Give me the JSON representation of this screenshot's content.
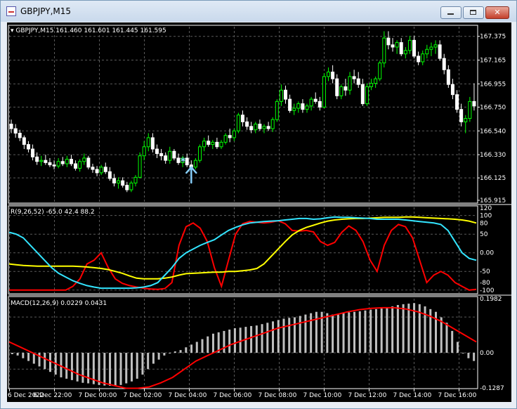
{
  "window": {
    "title": "GBPJPY,M15",
    "icon": "chart-window-icon",
    "minimize_icon": "minimize-icon",
    "maximize_icon": "maximize-icon",
    "close_icon": "close-icon",
    "close_glyph": "✕"
  },
  "colors": {
    "background": "#000000",
    "grid": "#5a5a5a",
    "bull_candle": "#00ff00",
    "bear_candle": "#ffffff",
    "axis_text": "#ffffff",
    "wpr_line": "#ff0000",
    "stoch_line": "#ffff00",
    "cyan_line": "#33e5ff",
    "macd_hist": "#c0c0c0",
    "macd_signal": "#ff0000",
    "arrow": "#87cefa"
  },
  "price_panel": {
    "header": "GBPJPY,M15  161.460 161.601 161.445 161.595",
    "price_axis": [
      "167.375",
      "167.165",
      "166.955",
      "166.750",
      "166.540",
      "166.330",
      "166.125",
      "165.915"
    ]
  },
  "osc_panel": {
    "label": "R(9,26,52) -65.0 42.4 88.2",
    "axis": [
      "120",
      "100",
      "80",
      "50",
      "0.00",
      "-50",
      "-80",
      "-100"
    ]
  },
  "macd_panel": {
    "label": "MACD(12,26,9) 0.0229 0.0431",
    "axis": [
      "0.1982",
      "0.00",
      "-0.1287"
    ]
  },
  "time_axis": [
    "6 Dec 2022",
    "6 Dec 22:00",
    "7 Dec 00:00",
    "7 Dec 02:00",
    "7 Dec 04:00",
    "7 Dec 06:00",
    "7 Dec 08:00",
    "7 Dec 10:00",
    "7 Dec 12:00",
    "7 Dec 14:00",
    "7 Dec 16:00"
  ],
  "chart_data": {
    "type": "candlestick",
    "symbol": "GBPJPY",
    "timeframe": "M15",
    "ylim": [
      165.915,
      167.46
    ],
    "ohlc": [
      [
        166.6,
        166.64,
        166.52,
        166.56
      ],
      [
        166.56,
        166.6,
        166.48,
        166.52
      ],
      [
        166.52,
        166.55,
        166.45,
        166.48
      ],
      [
        166.48,
        166.5,
        166.38,
        166.42
      ],
      [
        166.42,
        166.45,
        166.35,
        166.38
      ],
      [
        166.38,
        166.42,
        166.28,
        166.31
      ],
      [
        166.31,
        166.35,
        166.24,
        166.27
      ],
      [
        166.27,
        166.32,
        166.23,
        166.28
      ],
      [
        166.28,
        166.33,
        166.24,
        166.26
      ],
      [
        166.26,
        166.3,
        166.22,
        166.24
      ],
      [
        166.24,
        166.28,
        166.2,
        166.23
      ],
      [
        166.23,
        166.3,
        166.21,
        166.27
      ],
      [
        166.27,
        166.31,
        166.23,
        166.25
      ],
      [
        166.25,
        166.32,
        166.22,
        166.29
      ],
      [
        166.29,
        166.33,
        166.23,
        166.25
      ],
      [
        166.25,
        166.28,
        166.19,
        166.21
      ],
      [
        166.21,
        166.29,
        166.18,
        166.27
      ],
      [
        166.27,
        166.34,
        166.24,
        166.3
      ],
      [
        166.3,
        166.32,
        166.2,
        166.22
      ],
      [
        166.22,
        166.25,
        166.17,
        166.2
      ],
      [
        166.2,
        166.23,
        166.14,
        166.17
      ],
      [
        166.17,
        166.24,
        166.15,
        166.22
      ],
      [
        166.22,
        166.26,
        166.16,
        166.18
      ],
      [
        166.18,
        166.22,
        166.1,
        166.12
      ],
      [
        166.12,
        166.16,
        166.05,
        166.08
      ],
      [
        166.08,
        166.13,
        166.03,
        166.1
      ],
      [
        166.1,
        166.13,
        166.04,
        166.06
      ],
      [
        166.06,
        166.09,
        166.0,
        166.02
      ],
      [
        166.02,
        166.1,
        166.0,
        166.08
      ],
      [
        166.08,
        166.15,
        166.05,
        166.13
      ],
      [
        166.13,
        166.35,
        166.12,
        166.32
      ],
      [
        166.32,
        166.45,
        166.28,
        166.4
      ],
      [
        166.4,
        166.52,
        166.36,
        166.48
      ],
      [
        166.48,
        166.52,
        166.35,
        166.38
      ],
      [
        166.38,
        166.42,
        166.3,
        166.34
      ],
      [
        166.34,
        166.38,
        166.28,
        166.32
      ],
      [
        166.32,
        166.35,
        166.25,
        166.28
      ],
      [
        166.28,
        166.4,
        166.25,
        166.36
      ],
      [
        166.36,
        166.38,
        166.28,
        166.3
      ],
      [
        166.3,
        166.34,
        166.24,
        166.26
      ],
      [
        166.26,
        166.32,
        166.22,
        166.3
      ],
      [
        166.3,
        166.34,
        166.22,
        166.24
      ],
      [
        166.24,
        166.28,
        166.18,
        166.22
      ],
      [
        166.22,
        166.3,
        166.2,
        166.28
      ],
      [
        166.28,
        166.42,
        166.26,
        166.4
      ],
      [
        166.4,
        166.48,
        166.36,
        166.45
      ],
      [
        166.45,
        166.5,
        166.4,
        166.42
      ],
      [
        166.42,
        166.46,
        166.38,
        166.44
      ],
      [
        166.44,
        166.48,
        166.38,
        166.4
      ],
      [
        166.4,
        166.46,
        166.38,
        166.44
      ],
      [
        166.44,
        166.52,
        166.42,
        166.5
      ],
      [
        166.5,
        166.56,
        166.44,
        166.48
      ],
      [
        166.48,
        166.56,
        166.45,
        166.54
      ],
      [
        166.54,
        166.7,
        166.52,
        166.68
      ],
      [
        166.68,
        166.72,
        166.58,
        166.62
      ],
      [
        166.62,
        166.66,
        166.55,
        166.58
      ],
      [
        166.58,
        166.62,
        166.52,
        166.55
      ],
      [
        166.55,
        166.62,
        166.52,
        166.6
      ],
      [
        166.6,
        166.64,
        166.54,
        166.56
      ],
      [
        166.56,
        166.6,
        166.52,
        166.58
      ],
      [
        166.58,
        166.62,
        166.54,
        166.56
      ],
      [
        166.56,
        166.66,
        166.53,
        166.64
      ],
      [
        166.64,
        166.82,
        166.62,
        166.8
      ],
      [
        166.8,
        166.95,
        166.76,
        166.9
      ],
      [
        166.9,
        166.94,
        166.78,
        166.82
      ],
      [
        166.82,
        166.86,
        166.7,
        166.72
      ],
      [
        166.72,
        166.78,
        166.68,
        166.74
      ],
      [
        166.74,
        166.8,
        166.7,
        166.78
      ],
      [
        166.78,
        166.82,
        166.7,
        166.73
      ],
      [
        166.73,
        166.78,
        166.7,
        166.76
      ],
      [
        166.76,
        166.84,
        166.72,
        166.82
      ],
      [
        166.82,
        166.88,
        166.78,
        166.8
      ],
      [
        166.8,
        166.84,
        166.72,
        166.75
      ],
      [
        166.75,
        167.05,
        166.74,
        167.02
      ],
      [
        167.02,
        167.1,
        166.98,
        167.06
      ],
      [
        167.06,
        167.12,
        166.96,
        167.0
      ],
      [
        167.0,
        167.04,
        166.82,
        166.85
      ],
      [
        166.85,
        166.95,
        166.82,
        166.93
      ],
      [
        166.93,
        167.0,
        166.85,
        166.9
      ],
      [
        166.9,
        167.06,
        166.86,
        167.02
      ],
      [
        167.02,
        167.08,
        166.96,
        167.0
      ],
      [
        167.0,
        167.06,
        166.92,
        166.95
      ],
      [
        166.95,
        167.0,
        166.76,
        166.78
      ],
      [
        166.78,
        166.96,
        166.76,
        166.93
      ],
      [
        166.93,
        167.0,
        166.9,
        166.96
      ],
      [
        166.96,
        167.02,
        166.92,
        167.0
      ],
      [
        167.0,
        167.16,
        166.98,
        167.14
      ],
      [
        167.14,
        167.42,
        167.1,
        167.36
      ],
      [
        167.36,
        167.42,
        167.26,
        167.3
      ],
      [
        167.3,
        167.36,
        167.24,
        167.28
      ],
      [
        167.28,
        167.34,
        167.22,
        167.32
      ],
      [
        167.32,
        167.36,
        167.2,
        167.22
      ],
      [
        167.22,
        167.28,
        167.18,
        167.25
      ],
      [
        167.25,
        167.38,
        167.22,
        167.34
      ],
      [
        167.34,
        167.38,
        167.18,
        167.2
      ],
      [
        167.2,
        167.24,
        167.12,
        167.15
      ],
      [
        167.15,
        167.25,
        167.12,
        167.22
      ],
      [
        167.22,
        167.3,
        167.18,
        167.26
      ],
      [
        167.26,
        167.32,
        167.2,
        167.28
      ],
      [
        167.28,
        167.34,
        167.22,
        167.3
      ],
      [
        167.3,
        167.34,
        167.16,
        167.18
      ],
      [
        167.18,
        167.22,
        167.04,
        167.08
      ],
      [
        167.08,
        167.12,
        166.92,
        166.95
      ],
      [
        166.95,
        167.0,
        166.82,
        166.86
      ],
      [
        166.86,
        166.9,
        166.7,
        166.73
      ],
      [
        166.73,
        166.78,
        166.58,
        166.62
      ],
      [
        166.62,
        166.68,
        166.52,
        166.65
      ],
      [
        166.65,
        166.84,
        166.62,
        166.8
      ],
      [
        166.8,
        166.96,
        166.72,
        166.76
      ]
    ],
    "signal_marker": {
      "candle_index": 40,
      "price": 166.28
    },
    "arrow_marker": {
      "candle_index": 42,
      "price": 166.12
    },
    "oscillator": {
      "ylim": [
        -108,
        122
      ],
      "series": [
        {
          "name": "R(9)",
          "values": [
            -100,
            -100,
            -100,
            -100,
            -100,
            -100,
            -100,
            -100,
            -100,
            -90,
            -70,
            -30,
            -20,
            0,
            -40,
            -70,
            -82,
            -88,
            -92,
            -95,
            -97,
            -98,
            -96,
            -80,
            20,
            70,
            80,
            66,
            30,
            -40,
            -90,
            -20,
            50,
            78,
            84,
            82,
            80,
            82,
            86,
            78,
            60,
            58,
            60,
            56,
            30,
            20,
            28,
            55,
            72,
            60,
            30,
            -20,
            -50,
            20,
            60,
            76,
            70,
            40,
            -20,
            -80,
            -60,
            -50,
            -60,
            -80,
            -90,
            -100,
            -98
          ]
        },
        {
          "name": "R(26)",
          "values": [
            -30,
            -32,
            -34,
            -35,
            -36,
            -36,
            -36,
            -36,
            -36,
            -36,
            -37,
            -38,
            -40,
            -42,
            -45,
            -50,
            -55,
            -62,
            -68,
            -70,
            -70,
            -70,
            -68,
            -65,
            -60,
            -56,
            -55,
            -54,
            -53,
            -52,
            -52,
            -50,
            -50,
            -48,
            -46,
            -42,
            -30,
            -10,
            10,
            30,
            48,
            60,
            68,
            74,
            80,
            85,
            88,
            90,
            91,
            92,
            92,
            93,
            94,
            95,
            95,
            95,
            96,
            96,
            95,
            94,
            93,
            92,
            91,
            90,
            88,
            85,
            80
          ]
        },
        {
          "name": "R(52)",
          "values": [
            55,
            50,
            40,
            20,
            0,
            -20,
            -40,
            -55,
            -65,
            -75,
            -82,
            -88,
            -92,
            -95,
            -95,
            -95,
            -95,
            -95,
            -94,
            -92,
            -88,
            -80,
            -60,
            -40,
            -15,
            0,
            10,
            20,
            28,
            35,
            48,
            60,
            68,
            75,
            80,
            82,
            84,
            85,
            86,
            88,
            90,
            92,
            92,
            90,
            91,
            94,
            96,
            95,
            95,
            94,
            93,
            92,
            90,
            90,
            90,
            90,
            88,
            86,
            84,
            82,
            80,
            76,
            60,
            30,
            0,
            -15,
            -20
          ]
        }
      ]
    },
    "macd": {
      "ylim": [
        -0.1287,
        0.1982
      ],
      "histogram": [
        -0.005,
        -0.01,
        -0.02,
        -0.03,
        -0.04,
        -0.05,
        -0.06,
        -0.07,
        -0.08,
        -0.09,
        -0.095,
        -0.1,
        -0.105,
        -0.11,
        -0.112,
        -0.115,
        -0.118,
        -0.12,
        -0.121,
        -0.122,
        -0.118,
        -0.112,
        -0.105,
        -0.095,
        -0.08,
        -0.06,
        -0.04,
        -0.025,
        -0.01,
        0.0,
        0.005,
        0.01,
        0.02,
        0.03,
        0.04,
        0.05,
        0.06,
        0.07,
        0.075,
        0.08,
        0.085,
        0.09,
        0.092,
        0.095,
        0.098,
        0.1,
        0.105,
        0.11,
        0.115,
        0.12,
        0.125,
        0.128,
        0.13,
        0.135,
        0.14,
        0.145,
        0.15,
        0.15,
        0.145,
        0.14,
        0.142,
        0.145,
        0.148,
        0.15,
        0.152,
        0.155,
        0.158,
        0.16,
        0.162,
        0.165,
        0.17,
        0.175,
        0.178,
        0.18,
        0.182,
        0.178,
        0.17,
        0.16,
        0.15,
        0.13,
        0.11,
        0.08,
        0.04,
        0.0,
        -0.02,
        -0.03
      ],
      "signal": [
        0.04,
        0.02,
        0.0,
        -0.02,
        -0.04,
        -0.06,
        -0.08,
        -0.095,
        -0.11,
        -0.12,
        -0.13,
        -0.13,
        -0.125,
        -0.11,
        -0.09,
        -0.06,
        -0.03,
        -0.01,
        0.01,
        0.03,
        0.045,
        0.06,
        0.075,
        0.09,
        0.1,
        0.11,
        0.12,
        0.13,
        0.14,
        0.15,
        0.158,
        0.163,
        0.165,
        0.165,
        0.16,
        0.15,
        0.135,
        0.115,
        0.09,
        0.065,
        0.04
      ]
    }
  }
}
